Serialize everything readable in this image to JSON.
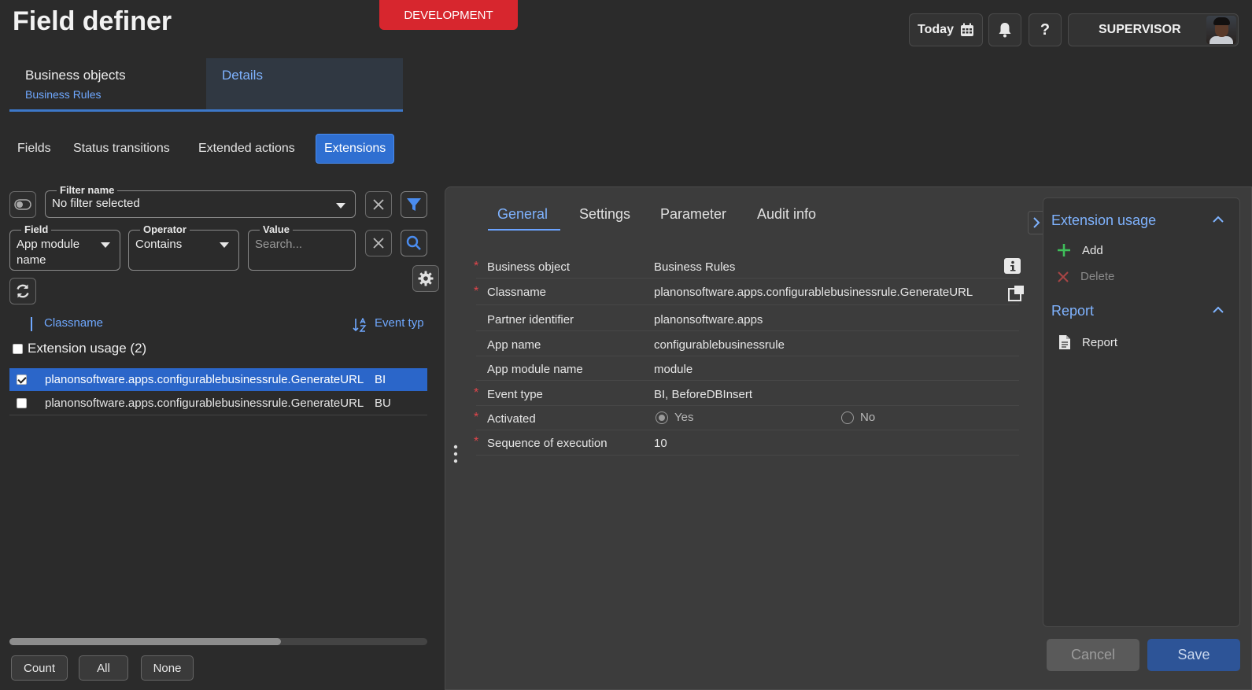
{
  "header": {
    "title": "Field definer",
    "environment": "DEVELOPMENT",
    "today_label": "Today",
    "user_name": "SUPERVISOR",
    "help_glyph": "?"
  },
  "main_tabs": [
    {
      "label": "Business objects",
      "sublabel": "Business Rules"
    },
    {
      "label": "Details"
    }
  ],
  "sub_tabs": [
    "Fields",
    "Status transitions",
    "Extended actions",
    "Extensions"
  ],
  "filter": {
    "filter_name_legend": "Filter name",
    "filter_name_value": "No filter selected",
    "field_legend": "Field",
    "field_value": "App module name",
    "operator_legend": "Operator",
    "operator_value": "Contains",
    "value_legend": "Value",
    "value_placeholder": "Search..."
  },
  "list": {
    "col_classname": "Classname",
    "col_event_type": "Event typ",
    "group_label": "Extension usage (2)",
    "rows": [
      {
        "classname": "planonsoftware.apps.configurablebusinessrule.GenerateURL",
        "event_type": "BI",
        "checked": true
      },
      {
        "classname": "planonsoftware.apps.configurablebusinessrule.GenerateURL",
        "event_type": "BU",
        "checked": false
      }
    ]
  },
  "footer_buttons": [
    "Count",
    "All",
    "None"
  ],
  "detail": {
    "tabs": [
      "General",
      "Settings",
      "Parameter",
      "Audit info"
    ],
    "fields": [
      {
        "label": "Business object",
        "value": "Business Rules",
        "required": true
      },
      {
        "label": "Classname",
        "value": "planonsoftware.apps.configurablebusinessrule.GenerateURL",
        "required": true
      },
      {
        "label": "Partner identifier",
        "value": "planonsoftware.apps",
        "required": false
      },
      {
        "label": "App name",
        "value": "configurablebusinessrule",
        "required": false
      },
      {
        "label": "App module name",
        "value": "module",
        "required": false
      },
      {
        "label": "Event type",
        "value": "BI, BeforeDBInsert",
        "required": true
      },
      {
        "label": "Activated",
        "value": "",
        "required": true
      },
      {
        "label": "Sequence of execution",
        "value": "10",
        "required": true
      }
    ],
    "activated_yes": "Yes",
    "activated_no": "No",
    "activated_selected": "Yes",
    "required_marker": "*"
  },
  "side_panel": {
    "extension_usage_title": "Extension usage",
    "add_label": "Add",
    "delete_label": "Delete",
    "report_title": "Report",
    "report_label": "Report"
  },
  "actions": {
    "cancel_label": "Cancel",
    "save_label": "Save"
  },
  "colors": {
    "accent": "#2b66c9",
    "link": "#6fa8ff",
    "environment_badge": "#d7262e",
    "required": "#e0454b",
    "add_icon": "#3fbf5a"
  }
}
